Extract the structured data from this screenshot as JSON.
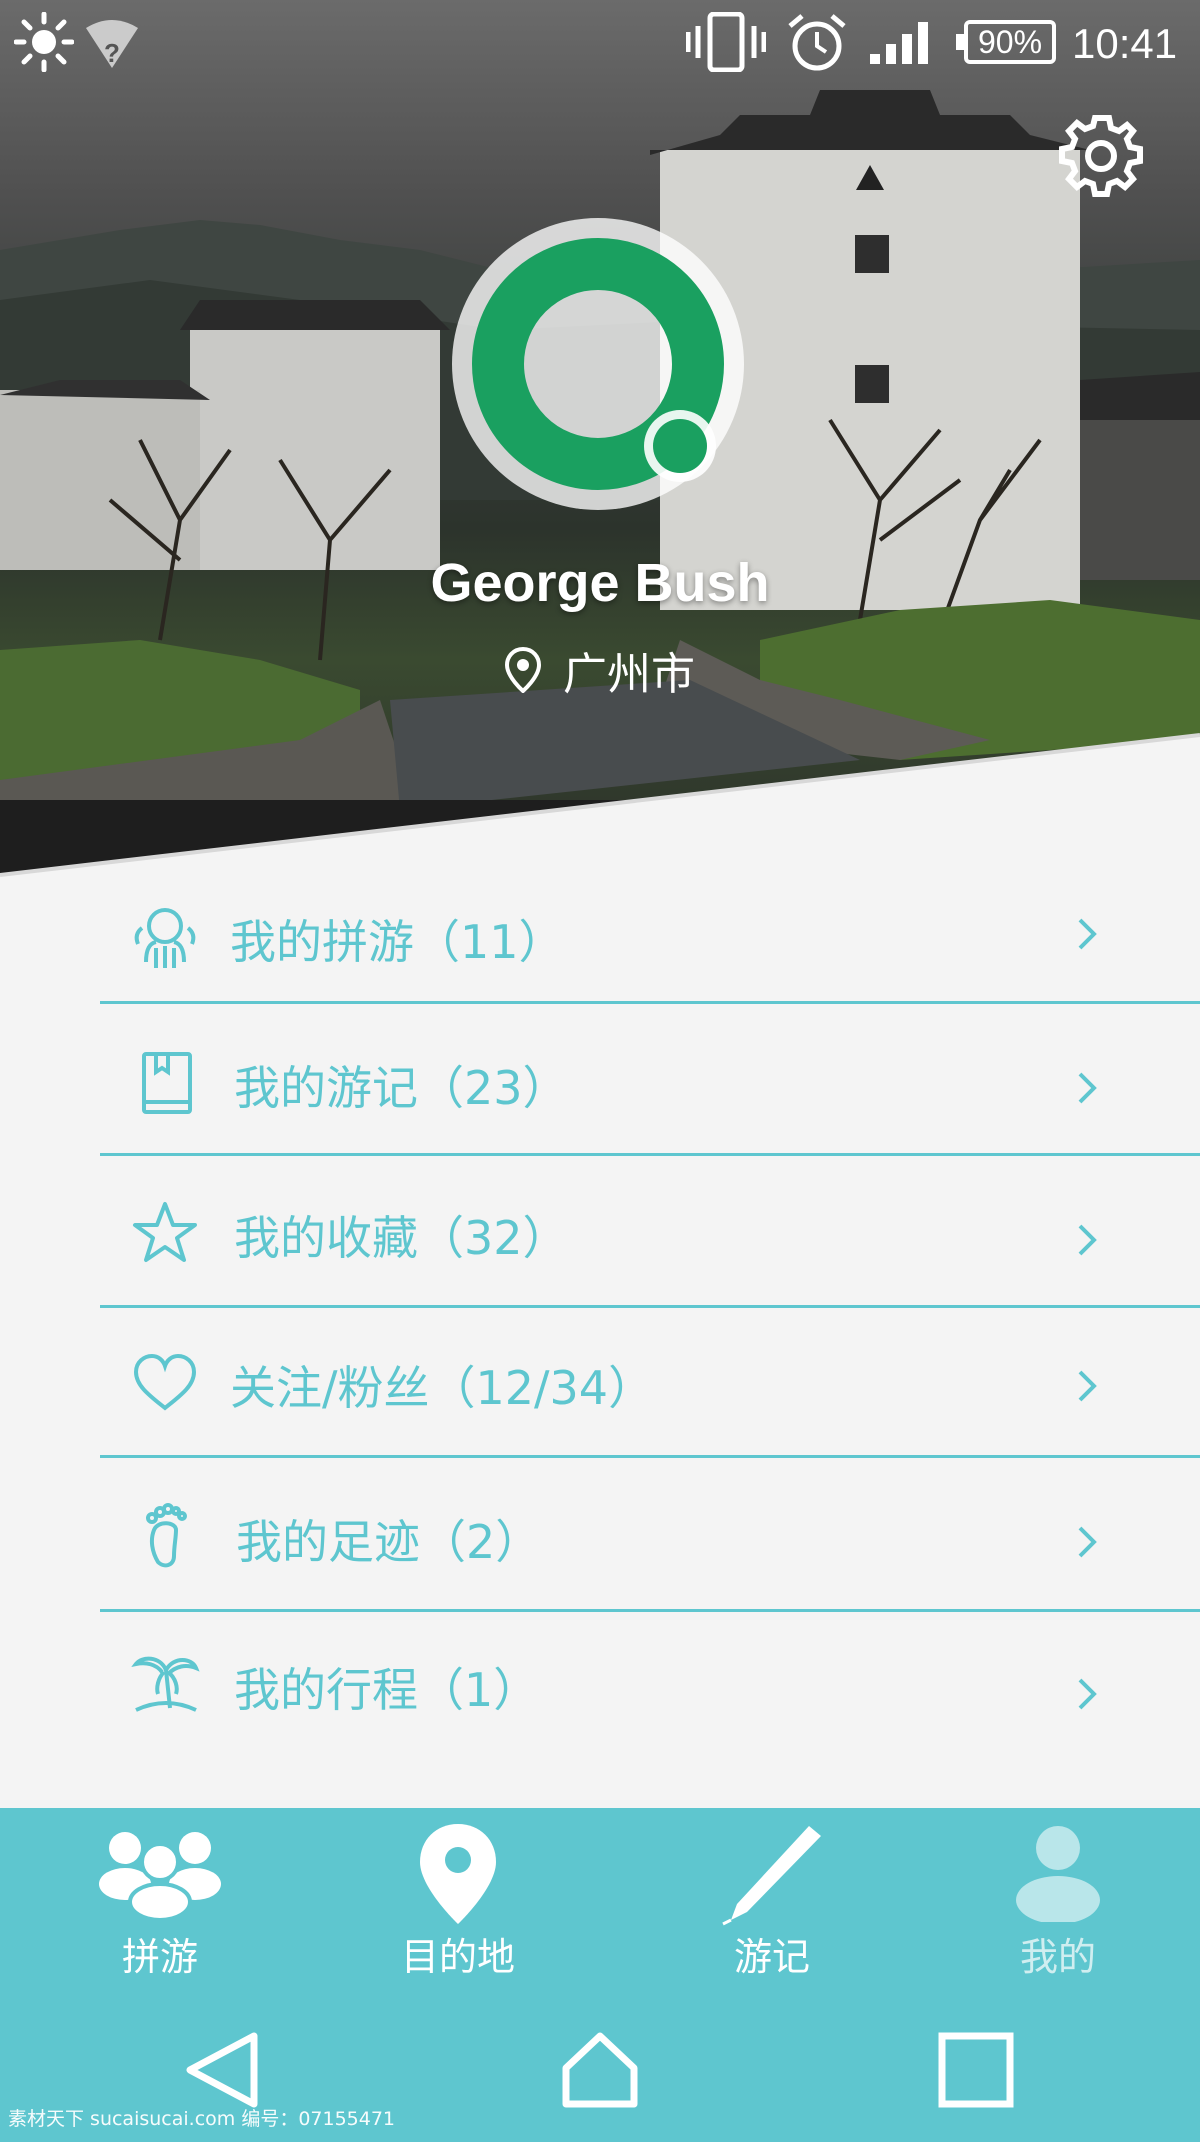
{
  "status_bar": {
    "battery": "90%",
    "time": "10:41",
    "icons": [
      "brightness-icon",
      "wifi-unknown-icon",
      "vibrate-icon",
      "alarm-icon",
      "signal-icon",
      "battery-icon"
    ]
  },
  "profile": {
    "name": "George Bush",
    "location": "广州市",
    "avatar_color": "#1aa060"
  },
  "menu": [
    {
      "label": "我的拼游（11）",
      "icon": "group-icon"
    },
    {
      "label": "我的游记（23）",
      "icon": "book-icon"
    },
    {
      "label": "我的收藏（32）",
      "icon": "star-icon"
    },
    {
      "label": "关注/粉丝（12/34）",
      "icon": "heart-icon"
    },
    {
      "label": "我的足迹（2）",
      "icon": "footprint-icon"
    },
    {
      "label": "我的行程（1）",
      "icon": "palm-tree-icon"
    }
  ],
  "tabs": [
    {
      "label": "拼游",
      "icon": "people-icon",
      "active": true
    },
    {
      "label": "目的地",
      "icon": "location-pin-icon",
      "active": true
    },
    {
      "label": "游记",
      "icon": "pen-icon",
      "active": true
    },
    {
      "label": "我的",
      "icon": "person-icon",
      "active": false
    }
  ],
  "nav": [
    "back-icon",
    "home-icon",
    "recents-icon"
  ],
  "watermark": "素材天下 sucaisucai.com   编号：07155471",
  "colors": {
    "accent": "#5ec6cf",
    "background": "#f4f4f4"
  }
}
